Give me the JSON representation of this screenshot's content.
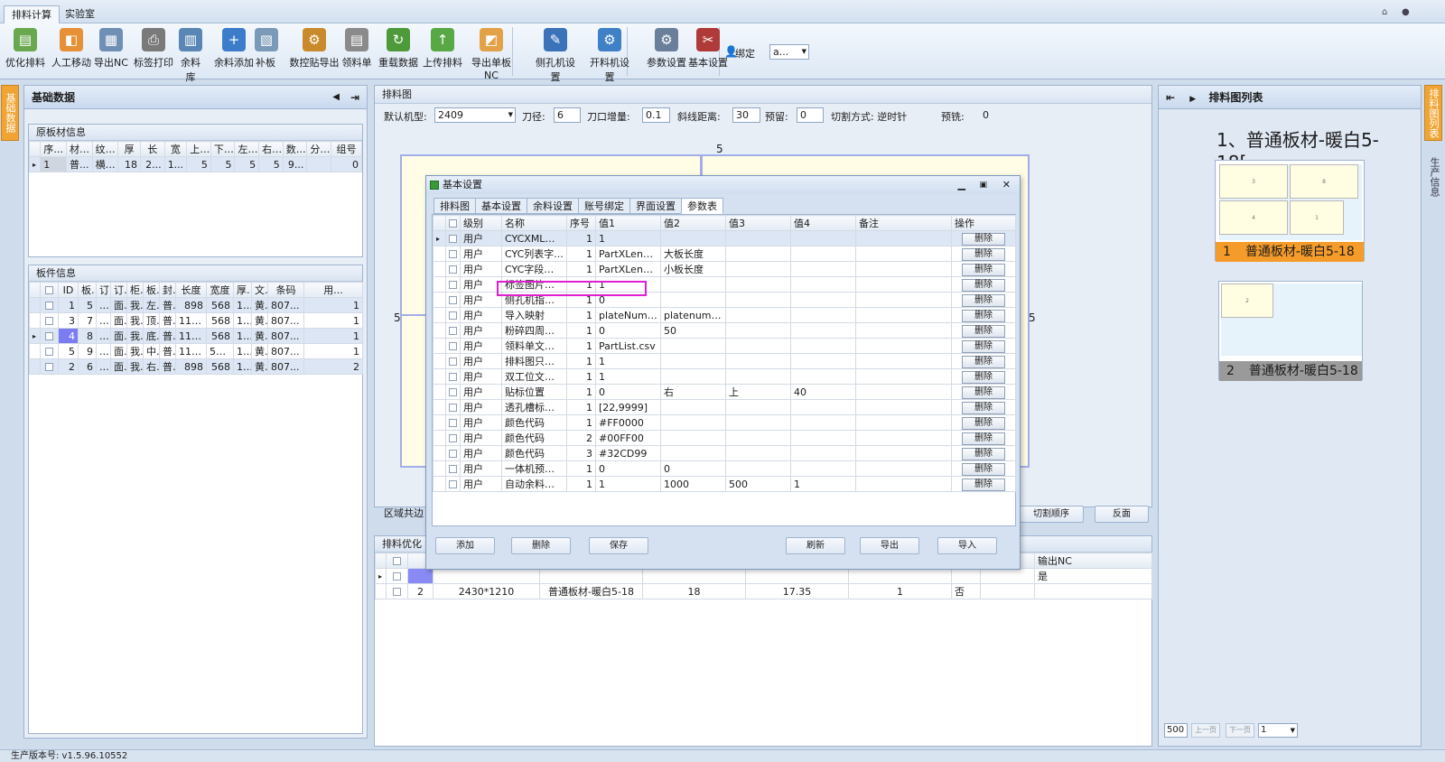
{
  "ribbon": {
    "tabs": [
      "排料计算",
      "实验室"
    ],
    "buttons": [
      {
        "label": "优化排料",
        "icon": "optimize-icon",
        "color": "#6aa84f"
      },
      {
        "label": "人工移动",
        "icon": "manual-move-icon",
        "color": "#e69138"
      },
      {
        "label": "导出NC",
        "icon": "export-nc-icon",
        "color": "#6f8fb5"
      },
      {
        "label": "标签打印",
        "icon": "printer-icon",
        "color": "#7a7a7a"
      },
      {
        "label": "余料库",
        "icon": "remnant-library-icon",
        "color": "#5a86b5"
      },
      {
        "label": "余料添加",
        "icon": "add-circle-icon",
        "color": "#3d7cc9"
      },
      {
        "label": "补板",
        "icon": "patch-board-icon",
        "color": "#7a9ab8"
      },
      {
        "label": "数控贴导出",
        "icon": "cnc-label-export-icon",
        "color": "#c98a2c"
      },
      {
        "label": "领料单",
        "icon": "requisition-icon",
        "color": "#8a8a8a"
      },
      {
        "label": "重载数据",
        "icon": "reload-icon",
        "color": "#4e9a3b"
      },
      {
        "label": "上传排料",
        "icon": "upload-icon",
        "color": "#58a845"
      },
      {
        "label": "导出单板NC",
        "icon": "export-single-nc-icon",
        "color": "#e3a148"
      },
      {
        "label": "侧孔机设置",
        "icon": "drill-icon",
        "color": "#3b72b8"
      },
      {
        "label": "开料机设置",
        "icon": "gear-icon",
        "color": "#3f80c7"
      },
      {
        "label": "参数设置",
        "icon": "parameter-settings-icon",
        "color": "#6a7f99"
      },
      {
        "label": "基本设置",
        "icon": "tools-icon",
        "color": "#b03a3a"
      }
    ],
    "bind_label": "绑定",
    "bind_value": "a..."
  },
  "left": {
    "title": "基础数据",
    "strip_label": "基础数据",
    "raw_section": "原板材信息",
    "raw_headers": [
      "",
      "序号",
      "材质",
      "纹理",
      "厚",
      "长",
      "宽",
      "上...",
      "下...",
      "左...",
      "右...",
      "数量",
      "分...",
      "组号"
    ],
    "raw_rows": [
      [
        "▸",
        "1",
        "普...",
        "横纹",
        "18",
        "2...",
        "1...",
        "5",
        "5",
        "5",
        "5",
        "9...",
        "",
        "0"
      ]
    ],
    "parts_section": "板件信息",
    "parts_headers": [
      "",
      "",
      "ID",
      "板..",
      "订..",
      "订..",
      "柜..",
      "板..",
      "封..",
      "长度",
      "宽度",
      "厚..",
      "文..",
      "条码",
      "用..."
    ],
    "parts_rows": [
      [
        "",
        "",
        "1",
        "5",
        "...",
        "面.",
        "我..",
        "左..",
        "普..",
        "898",
        "568",
        "18",
        "黄..",
        "807...",
        "1"
      ],
      [
        "",
        "",
        "3",
        "7",
        "...",
        "面.",
        "我..",
        "顶..",
        "普..",
        "1162",
        "568",
        "18",
        "黄..",
        "807...",
        "1"
      ],
      [
        "▸",
        "",
        "4",
        "8",
        "...",
        "面.",
        "我..",
        "底..",
        "普..",
        "1162",
        "568",
        "18",
        "黄..",
        "807...",
        "1"
      ],
      [
        "",
        "",
        "5",
        "9",
        "...",
        "面.",
        "我..",
        "中..",
        "普..",
        "116...",
        "567.8",
        "18",
        "黄..",
        "807...",
        "1"
      ],
      [
        "",
        "",
        "2",
        "6",
        "...",
        "面.",
        "我..",
        "右..",
        "普..",
        "898",
        "568",
        "18",
        "黄..",
        "807...",
        "2"
      ]
    ]
  },
  "center": {
    "title": "排料图",
    "machine_label": "默认机型:",
    "machine_value": "2409",
    "knife_label": "刀径:",
    "knife_value": "6",
    "kerf_label": "刀口增量:",
    "kerf_value": "0.1",
    "bevel_label": "斜线距离:",
    "bevel_value": "30",
    "reserve_label": "预留:",
    "reserve_value": "0",
    "cut_mode": "切割方式: 逆时针",
    "pre_mill_label": "预铣:",
    "pre_mill_value": "0",
    "dim_top": "5",
    "dim_left": "5",
    "dim_right": "5",
    "area_edge_label": "区域共边",
    "cut_order_button": "切割顺序",
    "reverse_button": "反面",
    "opt_section": "排料优化",
    "opt_headers": [
      "",
      "",
      "",
      "",
      "",
      "",
      "",
      "...板",
      "已加工",
      "输出NC"
    ],
    "opt_rows": [
      {
        "no": "",
        "size": "",
        "material": "",
        "thick": "",
        "rate": "",
        "qty": "",
        "flag": "",
        "nc": "是"
      },
      {
        "no": "2",
        "size": "2430*1210",
        "material": "普通板材-暖白5-18",
        "thick": "18",
        "rate": "17.35",
        "qty": "1",
        "flag": "否",
        "nc": ""
      }
    ]
  },
  "dialog": {
    "title": "基本设置",
    "tabs": [
      "排料图",
      "基本设置",
      "余料设置",
      "账号绑定",
      "界面设置",
      "参数表"
    ],
    "active_tab": 5,
    "headers": [
      "",
      "",
      "级别",
      "名称",
      "序号",
      "值1",
      "值2",
      "值3",
      "值4",
      "备注",
      "操作"
    ],
    "delete_label": "删除",
    "rows": [
      {
        "level": "用户",
        "name": "CYCXML反...",
        "seq": "1",
        "v1": "1",
        "v2": "",
        "v3": "",
        "v4": ""
      },
      {
        "level": "用户",
        "name": "CYC列表字...",
        "seq": "1",
        "v1": "PartXLength",
        "v2": "大板长度",
        "v3": "",
        "v4": ""
      },
      {
        "level": "用户",
        "name": "CYC字段映射",
        "seq": "1",
        "v1": "PartXLength",
        "v2": "小板长度",
        "v3": "",
        "v4": ""
      },
      {
        "level": "用户",
        "name": "标签图片文...",
        "seq": "1",
        "v1": "1",
        "v2": "",
        "v3": "",
        "v4": ""
      },
      {
        "level": "用户",
        "name": "侧孔机指示...",
        "seq": "1",
        "v1": "0",
        "v2": "",
        "v3": "",
        "v4": ""
      },
      {
        "level": "用户",
        "name": "导入映射",
        "seq": "1",
        "v1": "plateNumber",
        "v2": "platenumber",
        "v3": "",
        "v4": ""
      },
      {
        "level": "用户",
        "name": "粉碎四周废料",
        "seq": "1",
        "v1": "0",
        "v2": "50",
        "v3": "",
        "v4": ""
      },
      {
        "level": "用户",
        "name": "领料单文件名",
        "seq": "1",
        "v1": "PartList.csv",
        "v2": "",
        "v3": "",
        "v4": ""
      },
      {
        "level": "用户",
        "name": "排料图只找...",
        "seq": "1",
        "v1": "1",
        "v2": "",
        "v3": "",
        "v4": ""
      },
      {
        "level": "用户",
        "name": "双工位文件...",
        "seq": "1",
        "v1": "1",
        "v2": "",
        "v3": "",
        "v4": ""
      },
      {
        "level": "用户",
        "name": "贴标位置",
        "seq": "1",
        "v1": "0",
        "v2": "右",
        "v3": "上",
        "v4": "40"
      },
      {
        "level": "用户",
        "name": "透孔槽标识...",
        "seq": "1",
        "v1": "[22,9999]",
        "v2": "",
        "v3": "",
        "v4": ""
      },
      {
        "level": "用户",
        "name": "颜色代码",
        "seq": "1",
        "v1": "#FF0000",
        "v2": "",
        "v3": "",
        "v4": ""
      },
      {
        "level": "用户",
        "name": "颜色代码",
        "seq": "2",
        "v1": "#00FF00",
        "v2": "",
        "v3": "",
        "v4": ""
      },
      {
        "level": "用户",
        "name": "颜色代码",
        "seq": "3",
        "v1": "#32CD99",
        "v2": "",
        "v3": "",
        "v4": ""
      },
      {
        "level": "用户",
        "name": "一体机预修边",
        "seq": "1",
        "v1": "0",
        "v2": "0",
        "v3": "",
        "v4": ""
      },
      {
        "level": "用户",
        "name": "自动余料切断",
        "seq": "1",
        "v1": "1",
        "v2": "1000",
        "v3": "500",
        "v4": "1"
      }
    ],
    "buttons": {
      "add": "添加",
      "delete": "删除",
      "save": "保存",
      "refresh": "刷新",
      "export": "导出",
      "import": "导入"
    },
    "highlight_color": "#e020d0"
  },
  "right": {
    "title": "排料图列表",
    "big_title": "1、普通板材-暖白5-18[...",
    "strip_label": "排料图列表",
    "strip_label2": "生产信息",
    "items": [
      {
        "no": "1",
        "name": "普通板材-暖白5-18",
        "color": "#f59b2a"
      },
      {
        "no": "2",
        "name": "普通板材-暖白5-18",
        "color": "#9a9a9a"
      }
    ],
    "piece_labels_1": [
      "3",
      "8",
      "4",
      "1"
    ],
    "piece_labels_2": [
      "2"
    ],
    "page_size": "500",
    "prev_label": "上一页",
    "next_label": "下一页",
    "page_value": "1"
  },
  "status": {
    "version": "生产版本号:  v1.5.96.10552"
  }
}
